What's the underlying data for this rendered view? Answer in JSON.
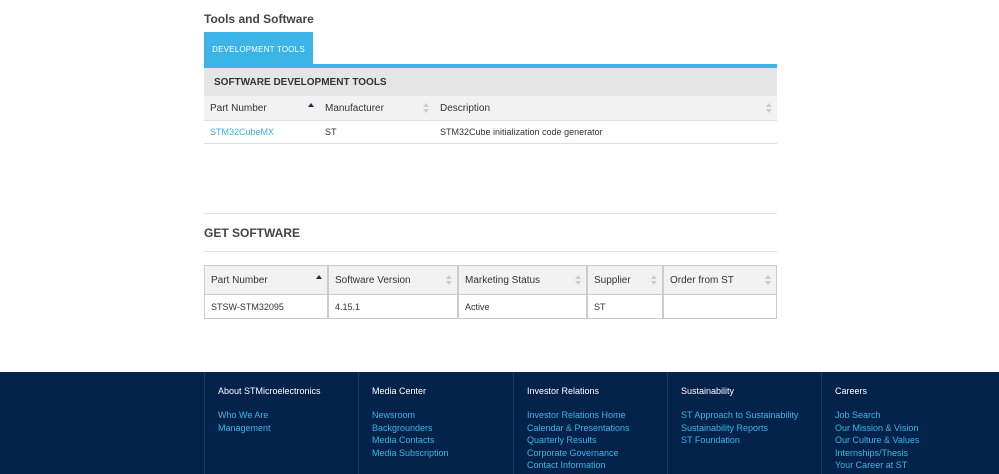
{
  "section_title": "Tools and Software",
  "tabs": [
    {
      "label": "DEVELOPMENT TOOLS"
    }
  ],
  "dev_tools": {
    "title": "SOFTWARE DEVELOPMENT TOOLS",
    "columns": [
      "Part Number",
      "Manufacturer",
      "Description"
    ],
    "rows": [
      {
        "part_number": "STM32CubeMX",
        "manufacturer": "ST",
        "description": "STM32Cube initialization code generator"
      }
    ]
  },
  "get_software": {
    "title": "GET SOFTWARE",
    "columns": [
      "Part Number",
      "Software Version",
      "Marketing Status",
      "Supplier",
      "Order from ST"
    ],
    "rows": [
      {
        "part_number": "STSW-STM32095",
        "version": "4.15.1",
        "status": "Active",
        "supplier": "ST",
        "order": ""
      }
    ]
  },
  "footer": {
    "columns": [
      {
        "title": "About STMicroelectronics",
        "links": [
          "Who We Are",
          "Management"
        ]
      },
      {
        "title": "Media Center",
        "links": [
          "Newsroom",
          "Backgrounders",
          "Media Contacts",
          "Media Subscription"
        ]
      },
      {
        "title": "Investor Relations",
        "links": [
          "Investor Relations Home",
          "Calendar & Presentations",
          "Quarterly Results",
          "Corporate Governance",
          "Contact Information"
        ]
      },
      {
        "title": "Sustainability",
        "links": [
          "ST Approach to Sustainability",
          "Sustainability Reports",
          "ST Foundation"
        ]
      },
      {
        "title": "Careers",
        "links": [
          "Job Search",
          "Our Mission & Vision",
          "Our Culture & Values",
          "Internships/Thesis",
          "Your Career at ST"
        ]
      }
    ]
  },
  "colors": {
    "accent": "#3cb4e5",
    "footer_bg": "#03234b"
  }
}
